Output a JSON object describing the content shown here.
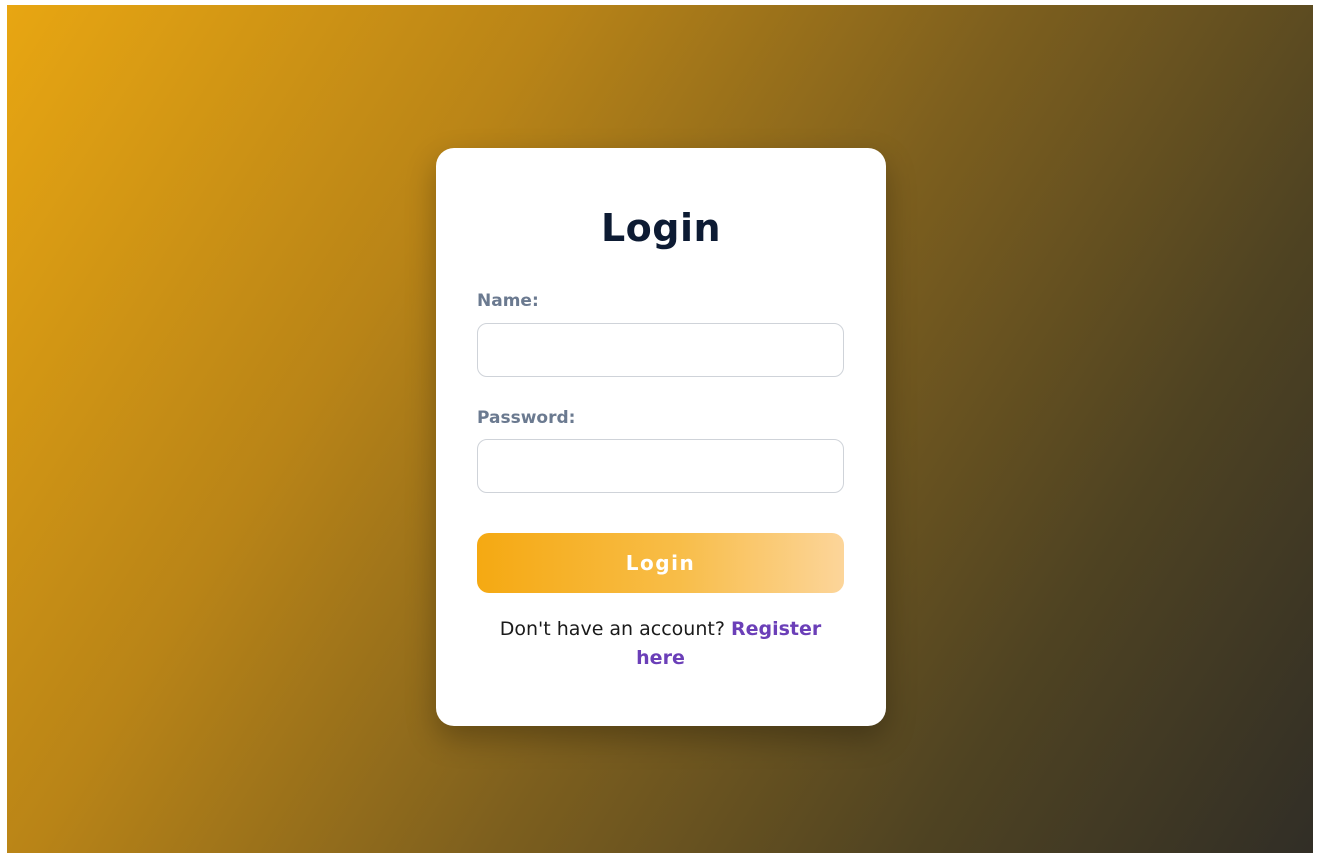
{
  "login_card": {
    "title": "Login",
    "fields": {
      "name": {
        "label": "Name:",
        "value": "",
        "placeholder": ""
      },
      "password": {
        "label": "Password:",
        "value": "",
        "placeholder": ""
      }
    },
    "submit_label": "Login",
    "footer": {
      "prompt": "Don't have an account?",
      "link_label": "Register here"
    }
  },
  "colors": {
    "background_gradient_start": "#e8a612",
    "background_gradient_end": "#312e26",
    "title": "#0d1b33",
    "label": "#6b7a90",
    "button_gradient_start": "#f5a912",
    "button_gradient_end": "#fcd59a",
    "link": "#6b3fb8"
  }
}
